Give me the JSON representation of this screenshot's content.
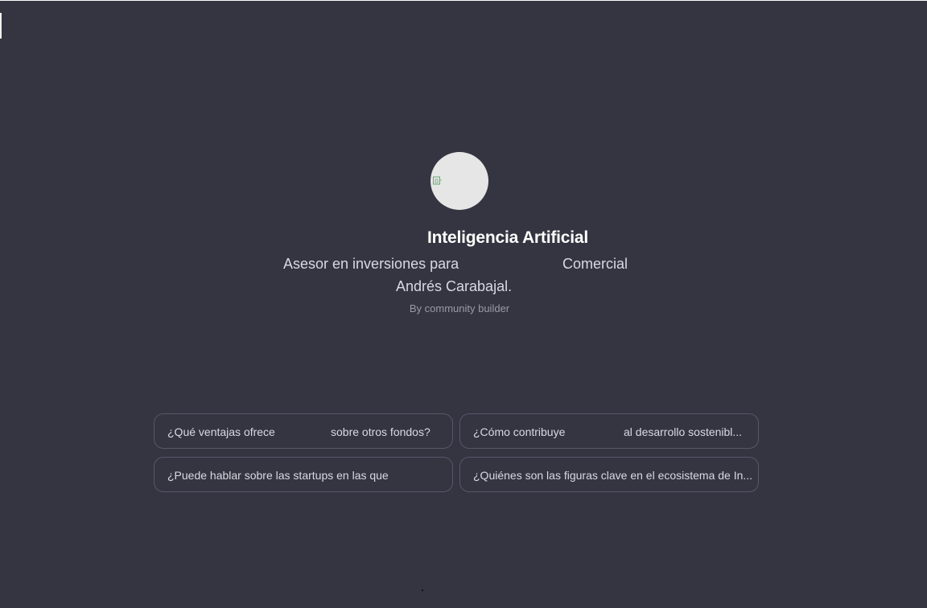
{
  "gpt": {
    "name": "Inteligencia Artificial",
    "description_line1_part1": "Asesor en inversiones para",
    "description_line1_part2": "Comercial",
    "description_line2": "Andrés Carabajal.",
    "byline": "By community builder"
  },
  "conversation_starters": [
    {
      "part1": "¿Qué ventajas ofrece",
      "part2": "sobre otros fondos?"
    },
    {
      "part1": "¿Cómo contribuye",
      "part2": "al desarrollo sostenibl..."
    },
    {
      "part1": "¿Puede hablar sobre las startups en las que",
      "part2": ""
    },
    {
      "part1": "¿Quiénes son las figuras clave en el ecosistema de In...",
      "part2": ""
    }
  ],
  "icons": {
    "avatar": "broken-image-icon"
  },
  "colors": {
    "background": "#343541",
    "avatar_background": "#e6e6e6",
    "card_border": "#565869",
    "title": "#ffffff",
    "text": "#d9d9e3",
    "byline": "#9a9aa6"
  }
}
